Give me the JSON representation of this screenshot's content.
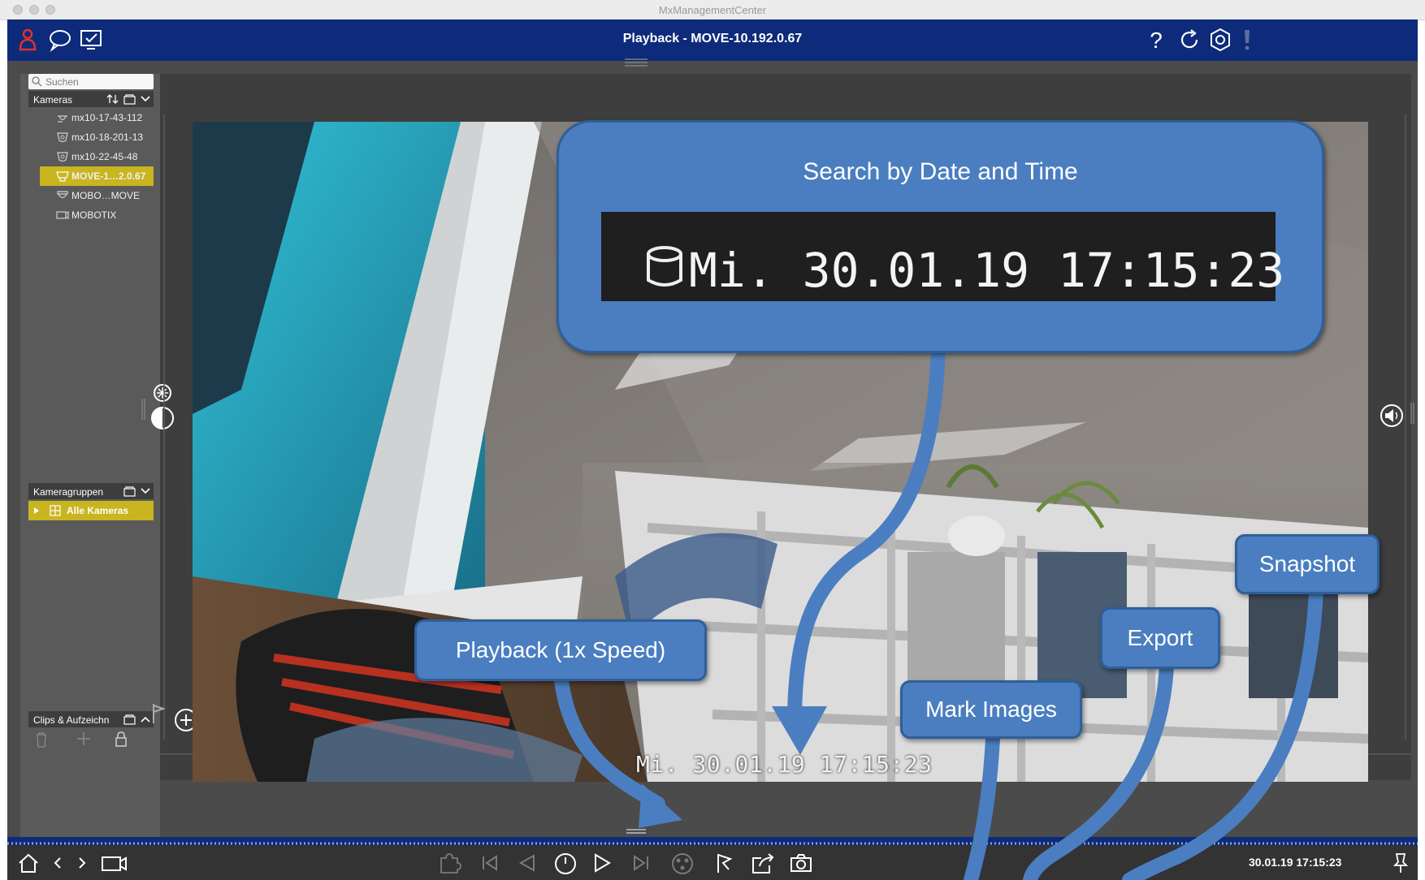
{
  "window": {
    "title": "MxManagementCenter"
  },
  "header": {
    "title": "Playback - MOVE-10.192.0.67"
  },
  "sidebar": {
    "search_placeholder": "Suchen",
    "cameras_header": "Kameras",
    "cameras": [
      {
        "label": "mx10-17-43-112",
        "icon": "camera-dome-icon",
        "selected": false
      },
      {
        "label": "mx10-18-201-13",
        "icon": "camera-hemispheric-icon",
        "selected": false
      },
      {
        "label": "mx10-22-45-48",
        "icon": "camera-hemispheric-icon",
        "selected": false
      },
      {
        "label": "MOVE-1…2.0.67",
        "icon": "camera-move-icon",
        "selected": true
      },
      {
        "label": "MOBO…MOVE",
        "icon": "camera-mobo-icon",
        "selected": false
      },
      {
        "label": "MOBOTIX",
        "icon": "camera-box-icon",
        "selected": false
      }
    ],
    "groups_header": "Kameragruppen",
    "groups": [
      {
        "label": "Alle Kameras",
        "selected": true
      }
    ],
    "clips_header": "Clips & Aufzeichn"
  },
  "video": {
    "osd": "Mi. 30.01.19 17:15:23"
  },
  "bottombar": {
    "time": "30.01.19 17:15:23"
  },
  "callouts": {
    "search": {
      "title": "Search by Date and Time",
      "zoom_text": "Mi. 30.01.19 17:15:23"
    },
    "playback": "Playback (1x Speed)",
    "mark": "Mark Images",
    "export": "Export",
    "snapshot": "Snapshot"
  },
  "colors": {
    "header": "#0d2b7a",
    "accent": "#c8b520",
    "callout": "#4a7ec0"
  }
}
